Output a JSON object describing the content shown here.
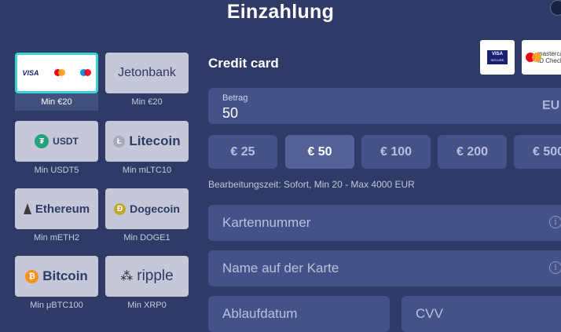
{
  "page": {
    "title": "Einzahlung"
  },
  "methods": [
    {
      "name": "Visa/Mastercard",
      "min": "Min €20",
      "selected": true
    },
    {
      "name": "Jetonbank",
      "min": "Min €20"
    },
    {
      "name": "USDT",
      "min": "Min USDT5"
    },
    {
      "name": "Litecoin",
      "min": "Min mLTC10"
    },
    {
      "name": "Ethereum",
      "min": "Min mETH2"
    },
    {
      "name": "Dogecoin",
      "min": "Min DOGE1"
    },
    {
      "name": "Bitcoin",
      "min": "Min μBTC100"
    },
    {
      "name": "ripple",
      "min": "Min XRP0"
    }
  ],
  "form": {
    "section_title": "Credit card",
    "badges": {
      "visa_secure": "VISA",
      "visa_secure_sub": "SECURE",
      "mastercard": "mastercard",
      "mastercard_sub": "ID Check"
    },
    "amount": {
      "label": "Betrag",
      "value": "50",
      "currency": "EU"
    },
    "presets": [
      "€ 25",
      "€ 50",
      "€ 100",
      "€ 200",
      "€ 500"
    ],
    "active_preset": "€ 50",
    "processing": "Bearbeitungszeit: Sofort, Min 20 - Max 4000 EUR",
    "fields": {
      "card_number": "Kartennummer",
      "card_name": "Name auf der Karte",
      "expiry": "Ablaufdatum",
      "cvv": "CVV"
    }
  },
  "colors": {
    "background": "#2f3a66",
    "field": "#45528a",
    "accent": "#3ed3d3"
  }
}
